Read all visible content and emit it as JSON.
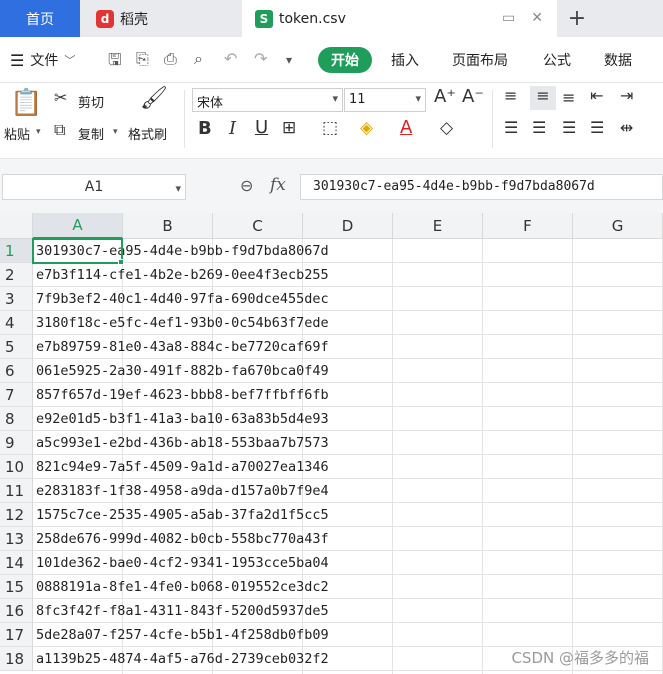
{
  "tabs": {
    "home": "首页",
    "daoke": "稻壳",
    "file": "token.csv",
    "add": "+"
  },
  "menu": {
    "file": "文件",
    "start": "开始",
    "insert": "插入",
    "page_layout": "页面布局",
    "formula": "公式",
    "data": "数据"
  },
  "ribbon": {
    "paste": "粘贴",
    "cut": "剪切",
    "copy": "复制",
    "format_painter": "格式刷",
    "font_name": "宋体",
    "font_size": "11"
  },
  "formula_bar": {
    "cell_ref": "A1",
    "fx": "fx",
    "value": "301930c7-ea95-4d4e-b9bb-f9d7bda8067d"
  },
  "grid": {
    "columns": [
      "A",
      "B",
      "C",
      "D",
      "E",
      "F",
      "G"
    ],
    "active_column": "A",
    "rows": [
      {
        "n": "1",
        "value": "301930c7-ea95-4d4e-b9bb-f9d7bda8067d"
      },
      {
        "n": "2",
        "value": "e7b3f114-cfe1-4b2e-b269-0ee4f3ecb255"
      },
      {
        "n": "3",
        "value": "7f9b3ef2-40c1-4d40-97fa-690dce455dec"
      },
      {
        "n": "4",
        "value": "3180f18c-e5fc-4ef1-93b0-0c54b63f7ede"
      },
      {
        "n": "5",
        "value": "e7b89759-81e0-43a8-884c-be7720caf69f"
      },
      {
        "n": "6",
        "value": "061e5925-2a30-491f-882b-fa670bca0f49"
      },
      {
        "n": "7",
        "value": "857f657d-19ef-4623-bbb8-bef7ffbff6fb"
      },
      {
        "n": "8",
        "value": "e92e01d5-b3f1-41a3-ba10-63a83b5d4e93"
      },
      {
        "n": "9",
        "value": "a5c993e1-e2bd-436b-ab18-553baa7b7573"
      },
      {
        "n": "10",
        "value": "821c94e9-7a5f-4509-9a1d-a70027ea1346"
      },
      {
        "n": "11",
        "value": "e283183f-1f38-4958-a9da-d157a0b7f9e4"
      },
      {
        "n": "12",
        "value": "1575c7ce-2535-4905-a5ab-37fa2d1f5cc5"
      },
      {
        "n": "13",
        "value": "258de676-999d-4082-b0cb-558bc770a43f"
      },
      {
        "n": "14",
        "value": "101de362-bae0-4cf2-9341-1953cce5ba04"
      },
      {
        "n": "15",
        "value": "0888191a-8fe1-4fe0-b068-019552ce3dc2"
      },
      {
        "n": "16",
        "value": "8fc3f42f-f8a1-4311-843f-5200d5937de5"
      },
      {
        "n": "17",
        "value": "5de28a07-f257-4cfe-b5b1-4f258db0fb09"
      },
      {
        "n": "18",
        "value": "a1139b25-4874-4af5-a76d-2739ceb032f2"
      }
    ]
  },
  "watermark": "CSDN @福多多的福",
  "colors": {
    "accent": "#1f9e5b",
    "home_tab": "#2f6fe0"
  }
}
